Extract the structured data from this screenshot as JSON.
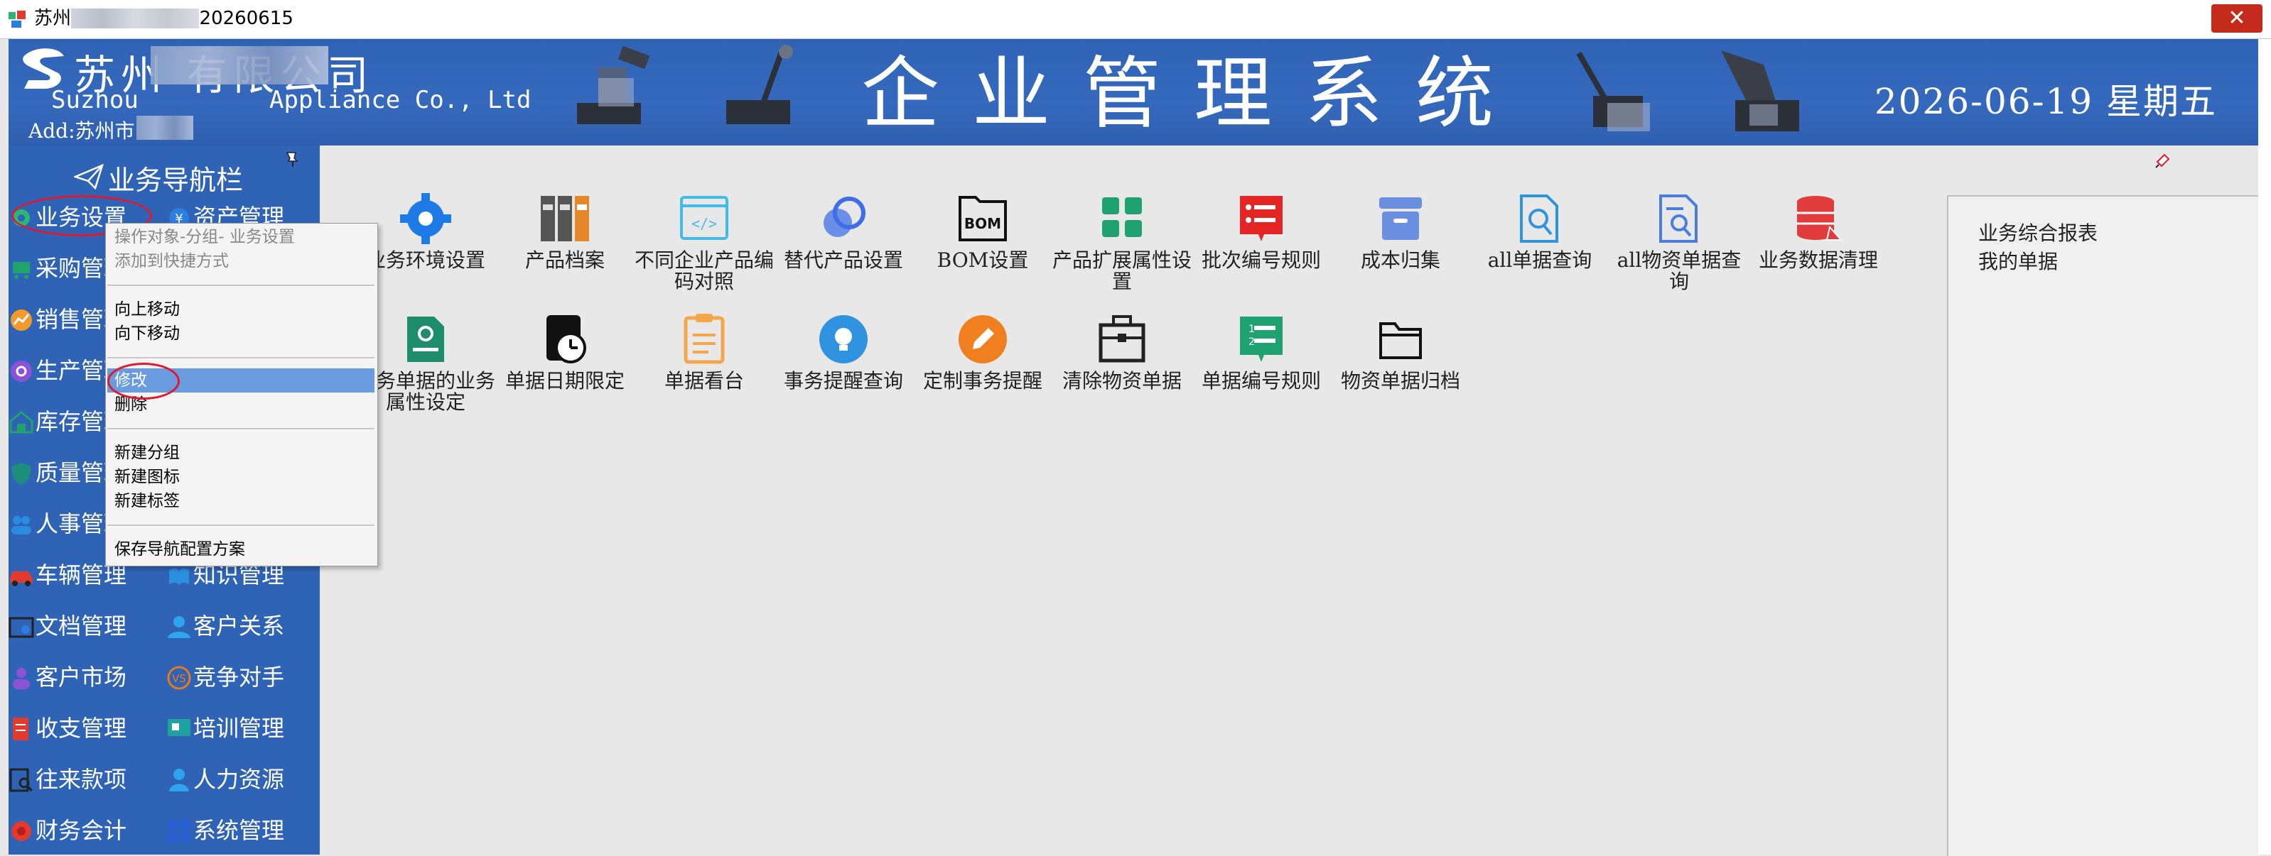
{
  "window": {
    "title": "苏州          ] 综合管理 oit 20260615",
    "close_symbol": "✕"
  },
  "header": {
    "company_name": "苏州        有限公司",
    "company_en": "Suzhou         Appliance Co., Ltd",
    "address": "Add:苏州市",
    "system_title": "企业管理系统",
    "date": "2026-06-19 星期五"
  },
  "sidebar": {
    "title": "业务导航栏",
    "items": [
      {
        "label": "业务设置",
        "icon": "gear-icon",
        "color": "#2bb673"
      },
      {
        "label": "资产管理",
        "icon": "asset-icon",
        "color": "#2b7de0"
      },
      {
        "label": "采购管理",
        "icon": "cart-icon",
        "color": "#1fa46b"
      },
      {
        "label": "销售管理",
        "icon": "chart-icon",
        "color": "#f39a2b"
      },
      {
        "label": "生产管理",
        "icon": "factory-icon",
        "color": "#8b52d6"
      },
      {
        "label": "库存管理",
        "icon": "warehouse-icon",
        "color": "#20a36b"
      },
      {
        "label": "质量管理",
        "icon": "shield-icon",
        "color": "#1c8e7a"
      },
      {
        "label": "人事管理",
        "icon": "people-icon",
        "color": "#2a8be0"
      },
      {
        "label": "车辆管理",
        "icon": "car-icon",
        "color": "#e23b2e"
      },
      {
        "label": "知识管理",
        "icon": "book-icon",
        "color": "#2b8fe0"
      },
      {
        "label": "文档管理",
        "icon": "document-icon",
        "color": "#222222"
      },
      {
        "label": "客户关系",
        "icon": "user-icon",
        "color": "#2fa5f0"
      },
      {
        "label": "客户市场",
        "icon": "customer-icon",
        "color": "#8b52d6"
      },
      {
        "label": "竞争对手",
        "icon": "vs-icon",
        "color": "#e47a1f"
      },
      {
        "label": "收支管理",
        "icon": "ledger-icon",
        "color": "#e23b2e"
      },
      {
        "label": "培训管理",
        "icon": "training-icon",
        "color": "#20a3a0"
      },
      {
        "label": "往来款项",
        "icon": "search-doc-icon",
        "color": "#222222"
      },
      {
        "label": "人力资源",
        "icon": "hr-icon",
        "color": "#2fa5f0"
      },
      {
        "label": "财务会计",
        "icon": "finance-icon",
        "color": "#e23b2e"
      },
      {
        "label": "系统管理",
        "icon": "system-icon",
        "color": "#2b5fd6"
      }
    ]
  },
  "context_menu": {
    "items": [
      {
        "label": "操作对象-分组-  业务设置",
        "disabled": true
      },
      {
        "label": "添加到快捷方式",
        "disabled": true
      },
      {
        "label": "向上移动"
      },
      {
        "label": "向下移动"
      },
      {
        "label": "修改",
        "selected": true
      },
      {
        "label": "删除"
      },
      {
        "label": "新建分组"
      },
      {
        "label": "新建图标"
      },
      {
        "label": "新建标签"
      },
      {
        "label": "保存导航配置方案"
      }
    ]
  },
  "grid": {
    "row1": [
      {
        "label": "业务环境设置",
        "icon": "gear-icon",
        "color": "#1e7be6"
      },
      {
        "label": "产品档案",
        "icon": "binders-icon",
        "color": "#555555"
      },
      {
        "label": "不同企业产品编码对照",
        "icon": "code-icon",
        "color": "#3fbde8"
      },
      {
        "label": "替代产品设置",
        "icon": "circles-icon",
        "color": "#3f6fe6"
      },
      {
        "label": "BOM设置",
        "icon": "bom-icon",
        "color": "#111111"
      },
      {
        "label": "产品扩展属性设置",
        "icon": "grid-icon",
        "color": "#1ea26f"
      },
      {
        "label": "批次编号规则",
        "icon": "numbered-list-icon",
        "color": "#e52424"
      },
      {
        "label": "成本归集",
        "icon": "archive-icon",
        "color": "#6a8fe0"
      },
      {
        "label": "all单据查询",
        "icon": "doc-search-icon",
        "color": "#2f93e0"
      },
      {
        "label": "all物资单据查询",
        "icon": "doc-search2-icon",
        "color": "#4a7de0"
      },
      {
        "label": "业务数据清理",
        "icon": "database-icon",
        "color": "#e23b3b"
      }
    ],
    "row2": [
      {
        "label": "业务单据的业务属性设定",
        "icon": "doc-gear-icon",
        "color": "#1e8e6a"
      },
      {
        "label": "单据日期限定",
        "icon": "clock-icon",
        "color": "#111111"
      },
      {
        "label": "单据看台",
        "icon": "clipboard-icon",
        "color": "#f3a64a"
      },
      {
        "label": "事务提醒查询",
        "icon": "bulb-icon",
        "color": "#2f93e0"
      },
      {
        "label": "定制事务提醒",
        "icon": "pencil-circle-icon",
        "color": "#f07f20"
      },
      {
        "label": "清除物资单据",
        "icon": "toolbox-icon",
        "color": "#222222"
      },
      {
        "label": "单据编号规则",
        "icon": "numbered-list2-icon",
        "color": "#1ea26f"
      },
      {
        "label": "物资单据归档",
        "icon": "folder-icon",
        "color": "#111111"
      }
    ]
  },
  "right_panel": {
    "items": [
      "业务综合报表",
      "我的单据"
    ]
  },
  "colors": {
    "banner": "#2f63b6",
    "accent_red": "#e0192f",
    "menu_selected": "#6a9ae0"
  }
}
